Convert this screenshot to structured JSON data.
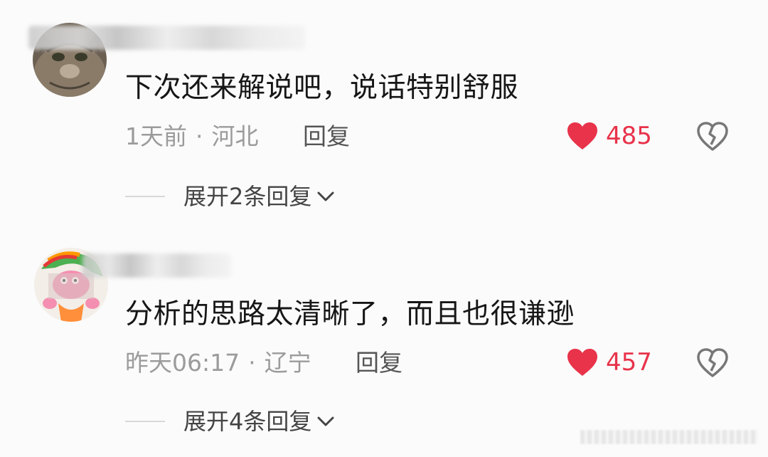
{
  "comments": [
    {
      "text": "下次还来解说吧，说话特别舒服",
      "time": "1天前",
      "separator": "·",
      "location": "河北",
      "reply_label": "回复",
      "like_count": "485",
      "expand_label": "展开2条回复"
    },
    {
      "text": "分析的思路太清晰了，而且也很谦逊",
      "time": "昨天06:17",
      "separator": "·",
      "location": "辽宁",
      "reply_label": "回复",
      "like_count": "457",
      "expand_label": "展开4条回复"
    }
  ],
  "colors": {
    "like": "#e8334a",
    "meta": "#9b9b9b",
    "text": "#161616"
  },
  "icons": [
    "heart-icon",
    "broken-heart-icon",
    "chevron-down-icon"
  ]
}
